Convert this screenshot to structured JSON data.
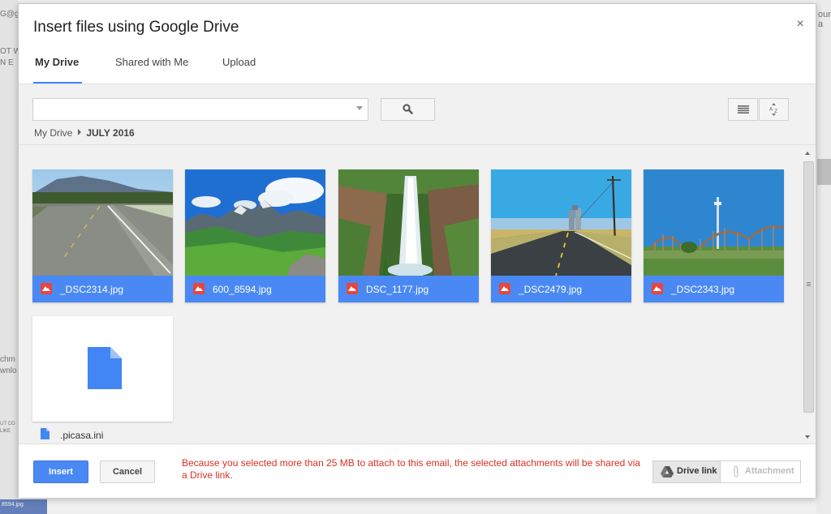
{
  "dialog": {
    "title": "Insert files using Google Drive",
    "tabs": [
      {
        "label": "My Drive"
      },
      {
        "label": "Shared with Me"
      },
      {
        "label": "Upload"
      }
    ]
  },
  "search": {
    "value": "",
    "placeholder": ""
  },
  "breadcrumb": {
    "root": "My Drive",
    "current": "JULY 2016"
  },
  "files": [
    {
      "name": "_DSC2314.jpg"
    },
    {
      "name": "600_8594.jpg"
    },
    {
      "name": "DSC_1177.jpg"
    },
    {
      "name": "_DSC2479.jpg"
    },
    {
      "name": "_DSC2343.jpg"
    },
    {
      "name": ".picasa.ini"
    }
  ],
  "footer": {
    "insert_label": "Insert",
    "cancel_label": "Cancel",
    "warning": "Because you selected more than 25 MB to attach to this email, the selected attachments will be shared via a Drive link.",
    "drive_link_label": "Drive link",
    "attachment_label": "Attachment"
  },
  "background": {
    "left_fragments": [
      "G@g",
      "OT W",
      "N E",
      "chm",
      "wnlo",
      "UT CO",
      "LIKE",
      "8594.jpg"
    ],
    "right_fragment": "our a"
  },
  "colors": {
    "accent": "#4a89f3",
    "warning": "#d93025",
    "image_icon": "#e8453c"
  }
}
